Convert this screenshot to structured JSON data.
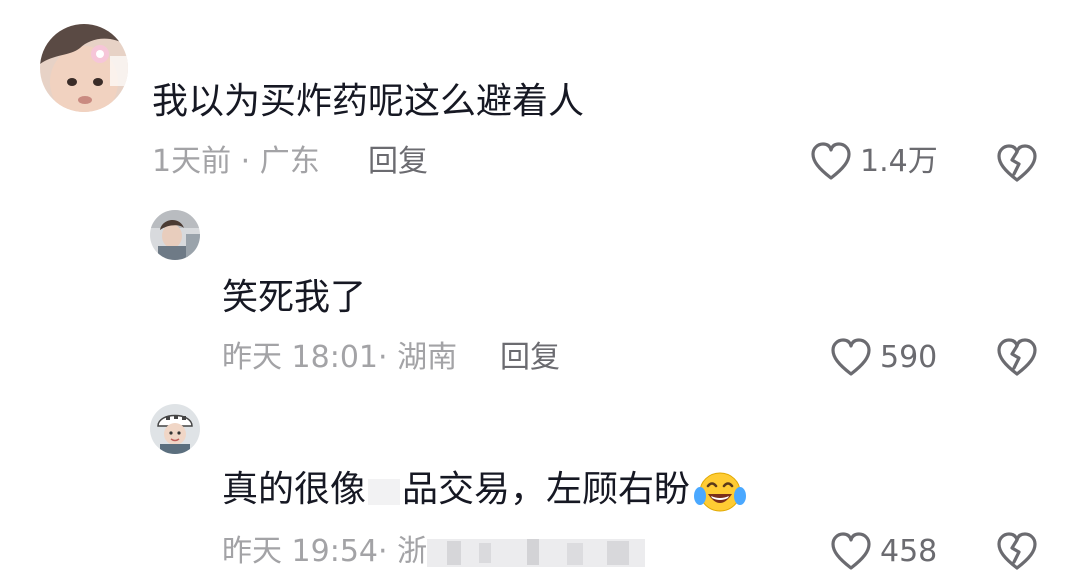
{
  "comments": [
    {
      "text": "我以为买炸药呢这么避着人",
      "time": "1天前",
      "location": "广东",
      "reply_label": "回复",
      "likes": "1.4万"
    },
    {
      "text": "笑死我了",
      "time": "昨天 18:01",
      "location": "湖南",
      "reply_label": "回复",
      "likes": "590"
    },
    {
      "text_before": "真的很像",
      "text_after": "品交易，左顾右盼",
      "emoji": "laughing-tears",
      "time": "昨天 19:54",
      "location_visible": "浙",
      "likes": "458"
    }
  ],
  "colors": {
    "text": "#161823",
    "meta": "#a3a3a6",
    "reply": "#6b6b70"
  }
}
